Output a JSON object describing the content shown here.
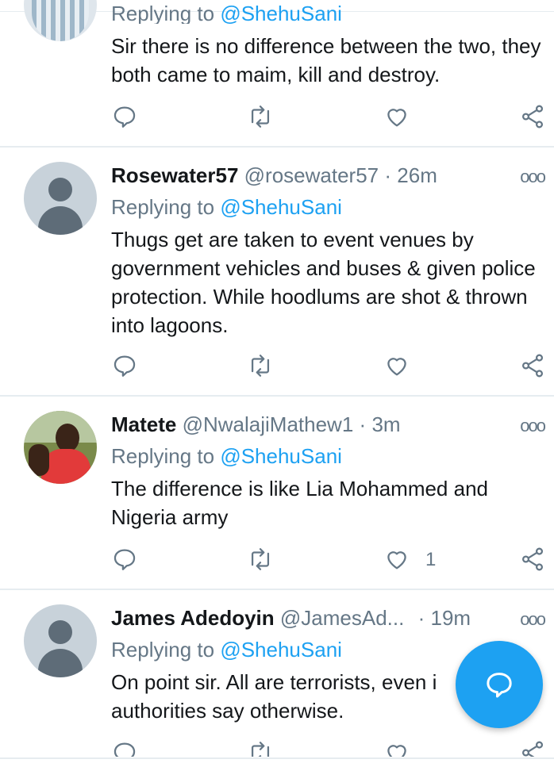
{
  "tweets": [
    {
      "name": "",
      "handle": "",
      "time": "",
      "replying_prefix": "Replying to",
      "mention": "@ShehuSani",
      "text": "Sir there is no difference between the two, they both came to maim, kill and destroy.",
      "likes": ""
    },
    {
      "name": "Rosewater57",
      "handle": "@rosewater57",
      "time": "26m",
      "replying_prefix": "Replying to",
      "mention": "@ShehuSani",
      "text": "Thugs get are taken to event venues by government vehicles and buses & given police protection. While hoodlums are shot & thrown into lagoons.",
      "likes": ""
    },
    {
      "name": "Matete",
      "handle": "@NwalajiMathew1",
      "time": "3m",
      "replying_prefix": "Replying to",
      "mention": "@ShehuSani",
      "text": "The difference is like Lia Mohammed and Nigeria army",
      "likes": "1"
    },
    {
      "name": "James Adedoyin",
      "handle": "@JamesAd...",
      "time": "19m",
      "replying_prefix": "Replying to",
      "mention": "@ShehuSani",
      "text": "On point sir. All are terrorists, even i authorities say otherwise.",
      "likes": ""
    }
  ],
  "dot_separator": "·",
  "more_glyph": "ooo",
  "icons": {
    "reply": "reply-icon",
    "retweet": "retweet-icon",
    "like": "heart-icon",
    "share": "share-icon",
    "compose": "compose-reply-icon"
  },
  "colors": {
    "accent": "#1da1f2",
    "secondary_text": "#657786",
    "divider": "#e6ecf0"
  }
}
